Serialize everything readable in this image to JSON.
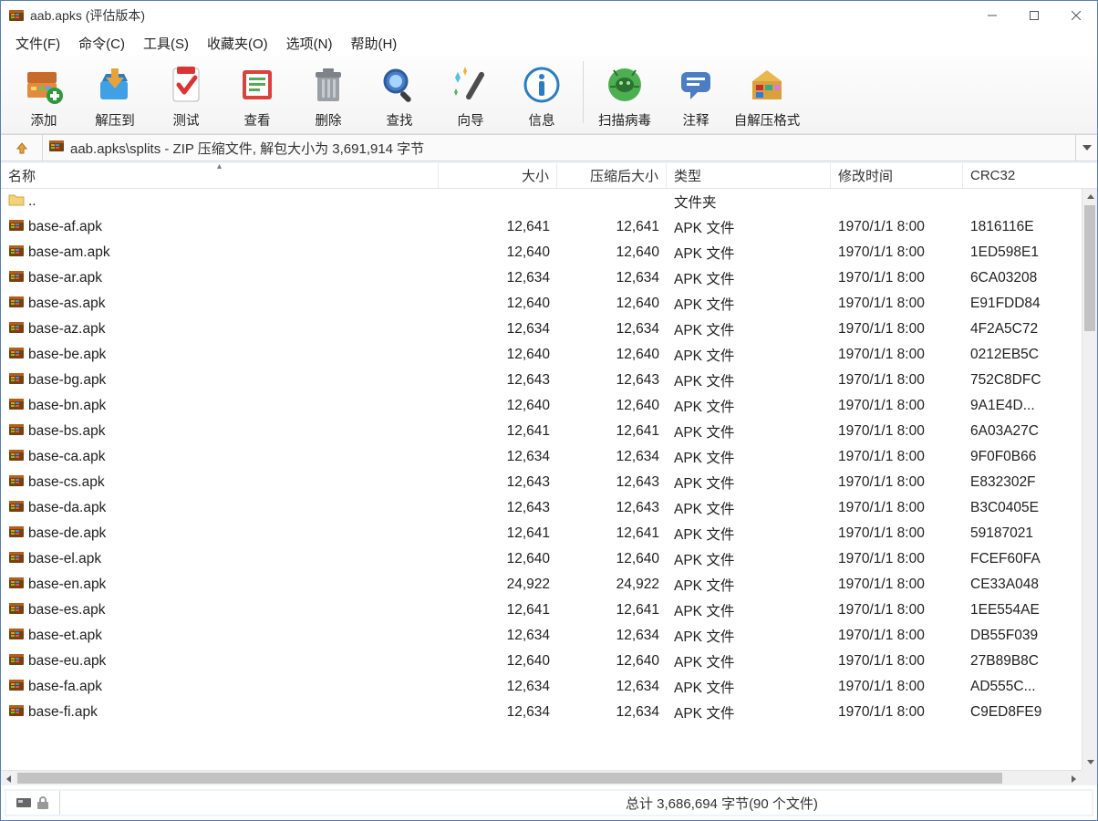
{
  "title": "aab.apks (评估版本)",
  "menu": [
    "文件(F)",
    "命令(C)",
    "工具(S)",
    "收藏夹(O)",
    "选项(N)",
    "帮助(H)"
  ],
  "toolbar": [
    {
      "label": "添加"
    },
    {
      "label": "解压到"
    },
    {
      "label": "测试"
    },
    {
      "label": "查看"
    },
    {
      "label": "删除"
    },
    {
      "label": "查找"
    },
    {
      "label": "向导"
    },
    {
      "label": "信息"
    },
    {
      "label": "扫描病毒"
    },
    {
      "label": "注释"
    },
    {
      "label": "自解压格式"
    }
  ],
  "location": "aab.apks\\splits - ZIP 压缩文件, 解包大小为 3,691,914 字节",
  "columns": {
    "name": "名称",
    "size": "大小",
    "csize": "压缩后大小",
    "type": "类型",
    "mtime": "修改时间",
    "crc": "CRC32"
  },
  "parent_row": {
    "name": "..",
    "type": "文件夹"
  },
  "files": [
    {
      "name": "base-af.apk",
      "size": "12,641",
      "csize": "12,641",
      "type": "APK 文件",
      "mtime": "1970/1/1 8:00",
      "crc": "1816116E"
    },
    {
      "name": "base-am.apk",
      "size": "12,640",
      "csize": "12,640",
      "type": "APK 文件",
      "mtime": "1970/1/1 8:00",
      "crc": "1ED598E1"
    },
    {
      "name": "base-ar.apk",
      "size": "12,634",
      "csize": "12,634",
      "type": "APK 文件",
      "mtime": "1970/1/1 8:00",
      "crc": "6CA03208"
    },
    {
      "name": "base-as.apk",
      "size": "12,640",
      "csize": "12,640",
      "type": "APK 文件",
      "mtime": "1970/1/1 8:00",
      "crc": "E91FDD84"
    },
    {
      "name": "base-az.apk",
      "size": "12,634",
      "csize": "12,634",
      "type": "APK 文件",
      "mtime": "1970/1/1 8:00",
      "crc": "4F2A5C72"
    },
    {
      "name": "base-be.apk",
      "size": "12,640",
      "csize": "12,640",
      "type": "APK 文件",
      "mtime": "1970/1/1 8:00",
      "crc": "0212EB5C"
    },
    {
      "name": "base-bg.apk",
      "size": "12,643",
      "csize": "12,643",
      "type": "APK 文件",
      "mtime": "1970/1/1 8:00",
      "crc": "752C8DFC"
    },
    {
      "name": "base-bn.apk",
      "size": "12,640",
      "csize": "12,640",
      "type": "APK 文件",
      "mtime": "1970/1/1 8:00",
      "crc": "9A1E4D..."
    },
    {
      "name": "base-bs.apk",
      "size": "12,641",
      "csize": "12,641",
      "type": "APK 文件",
      "mtime": "1970/1/1 8:00",
      "crc": "6A03A27C"
    },
    {
      "name": "base-ca.apk",
      "size": "12,634",
      "csize": "12,634",
      "type": "APK 文件",
      "mtime": "1970/1/1 8:00",
      "crc": "9F0F0B66"
    },
    {
      "name": "base-cs.apk",
      "size": "12,643",
      "csize": "12,643",
      "type": "APK 文件",
      "mtime": "1970/1/1 8:00",
      "crc": "E832302F"
    },
    {
      "name": "base-da.apk",
      "size": "12,643",
      "csize": "12,643",
      "type": "APK 文件",
      "mtime": "1970/1/1 8:00",
      "crc": "B3C0405E"
    },
    {
      "name": "base-de.apk",
      "size": "12,641",
      "csize": "12,641",
      "type": "APK 文件",
      "mtime": "1970/1/1 8:00",
      "crc": "59187021"
    },
    {
      "name": "base-el.apk",
      "size": "12,640",
      "csize": "12,640",
      "type": "APK 文件",
      "mtime": "1970/1/1 8:00",
      "crc": "FCEF60FA"
    },
    {
      "name": "base-en.apk",
      "size": "24,922",
      "csize": "24,922",
      "type": "APK 文件",
      "mtime": "1970/1/1 8:00",
      "crc": "CE33A048"
    },
    {
      "name": "base-es.apk",
      "size": "12,641",
      "csize": "12,641",
      "type": "APK 文件",
      "mtime": "1970/1/1 8:00",
      "crc": "1EE554AE"
    },
    {
      "name": "base-et.apk",
      "size": "12,634",
      "csize": "12,634",
      "type": "APK 文件",
      "mtime": "1970/1/1 8:00",
      "crc": "DB55F039"
    },
    {
      "name": "base-eu.apk",
      "size": "12,640",
      "csize": "12,640",
      "type": "APK 文件",
      "mtime": "1970/1/1 8:00",
      "crc": "27B89B8C"
    },
    {
      "name": "base-fa.apk",
      "size": "12,634",
      "csize": "12,634",
      "type": "APK 文件",
      "mtime": "1970/1/1 8:00",
      "crc": "AD555C..."
    },
    {
      "name": "base-fi.apk",
      "size": "12,634",
      "csize": "12,634",
      "type": "APK 文件",
      "mtime": "1970/1/1 8:00",
      "crc": "C9ED8FE9"
    }
  ],
  "status": "总计 3,686,694 字节(90 个文件)"
}
